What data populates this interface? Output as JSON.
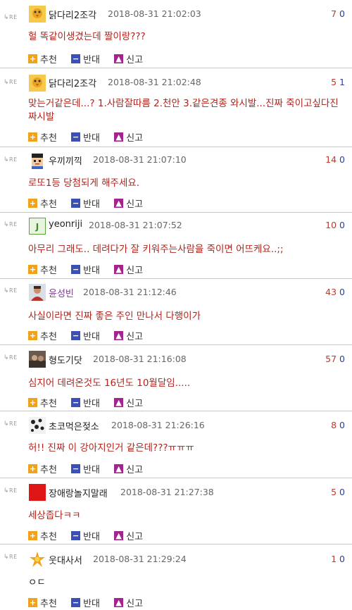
{
  "reply_tag": "RE",
  "action_labels": {
    "recommend": "추천",
    "oppose": "반대",
    "report": "신고"
  },
  "comments": [
    {
      "nick": "닭다리2조각",
      "time": "2018-08-31 21:02:03",
      "up": "7",
      "down": "0",
      "text": "헐 똑같이생겼는데 짤이랑???",
      "avatar": "chick-avatar"
    },
    {
      "nick": "닭다리2조각",
      "time": "2018-08-31 21:02:48",
      "up": "5",
      "down": "1",
      "text": "맞는거같은데...? 1.사람잘따름 2.천안 3.같은견종 와시발...진짜 죽이고싶다진짜시발",
      "avatar": "chick-avatar"
    },
    {
      "nick": "우끼끼끽",
      "time": "2018-08-31 21:07:10",
      "up": "14",
      "down": "0",
      "text": "로또1등 당첨되게 해주세요.",
      "avatar": "pixel-face-avatar"
    },
    {
      "nick": "yeonriji",
      "time": "2018-08-31 21:07:52",
      "up": "10",
      "down": "0",
      "text": "아무리 그래도.. 데려다가 잘 키워주는사람을 죽이면 어뜨케요..;;",
      "avatar": "green-text-avatar"
    },
    {
      "nick": "윤성빈",
      "time": "2018-08-31 21:12:46",
      "up": "43",
      "down": "0",
      "text": "사실이라면 진짜 좋은 주인 만나서 다행이가",
      "avatar": "person-avatar"
    },
    {
      "nick": "형도기닷",
      "time": "2018-08-31 21:16:08",
      "up": "57",
      "down": "0",
      "text": "심지어 데려온것도 16년도 10월달임.....",
      "avatar": "photo-avatar"
    },
    {
      "nick": "초코먹은젖소",
      "time": "2018-08-31 21:26:16",
      "up": "8",
      "down": "0",
      "text": "허!! 진짜 이 강아지인거 같은데???ㅠㅠㅠ",
      "avatar": "cow-avatar"
    },
    {
      "nick": "장애랑놀지말래",
      "time": "2018-08-31 21:27:38",
      "up": "5",
      "down": "0",
      "text": "세상좁다ㅋㅋ",
      "avatar": "red-square-avatar"
    },
    {
      "nick": "웃대사서",
      "time": "2018-08-31 21:29:24",
      "up": "1",
      "down": "0",
      "text": "ㅇㄷ",
      "avatar": "star-avatar"
    }
  ]
}
